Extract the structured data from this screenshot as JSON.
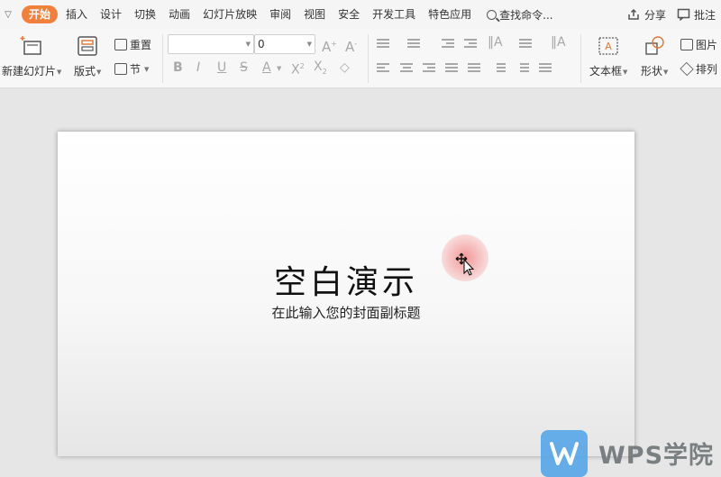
{
  "menu": {
    "tabs": [
      {
        "label": "开始",
        "active": true
      },
      {
        "label": "插入"
      },
      {
        "label": "设计"
      },
      {
        "label": "切换"
      },
      {
        "label": "动画"
      },
      {
        "label": "幻灯片放映"
      },
      {
        "label": "审阅"
      },
      {
        "label": "视图"
      },
      {
        "label": "安全"
      },
      {
        "label": "开发工具"
      },
      {
        "label": "特色应用"
      }
    ],
    "search_label": "查找命令...",
    "share_label": "分享",
    "comment_label": "批注"
  },
  "ribbon": {
    "new_slide_label": "新建幻灯片",
    "layout_label": "版式",
    "reset_label": "重置",
    "section_label": "节",
    "font_name_value": "",
    "font_size_value": "0",
    "textbox_label": "文本框",
    "shape_label": "形状",
    "picture_label": "图片",
    "arrange_label": "排列"
  },
  "slide": {
    "title": "空白演示",
    "subtitle": "在此输入您的封面副标题"
  },
  "watermark": {
    "text": "WPS学院"
  },
  "colors": {
    "accent": "#f0803c",
    "watermark_blue": "#5aa8e8",
    "background": "#e6e6e6"
  }
}
